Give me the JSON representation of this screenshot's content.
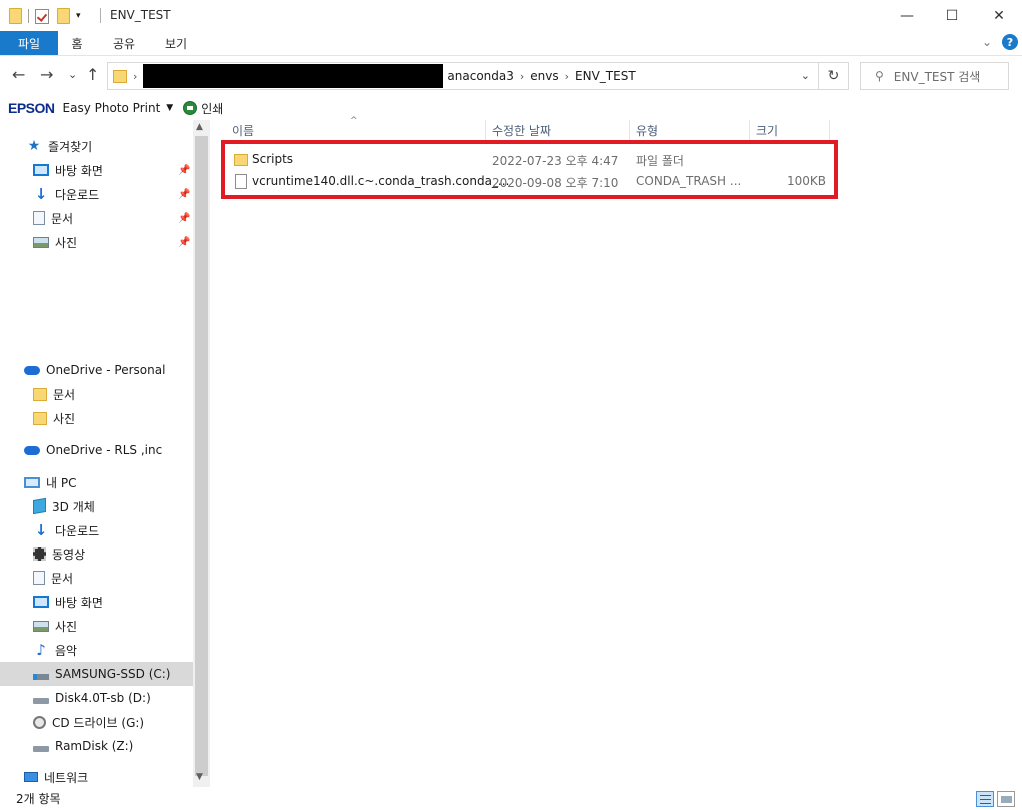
{
  "window": {
    "title": "ENV_TEST",
    "controls": {
      "minimize": "—",
      "maximize": "☐",
      "close": "✕"
    }
  },
  "ribbon": {
    "tabs": [
      "파일",
      "홈",
      "공유",
      "보기"
    ],
    "expand": "⌄",
    "help": "?"
  },
  "address": {
    "back": "←",
    "forward": "→",
    "recent": "⌄",
    "up": "↑",
    "crumbs": [
      "anaconda3",
      "envs",
      "ENV_TEST"
    ],
    "dropdown": "⌄",
    "refresh": "↻",
    "search_placeholder": "ENV_TEST 검색"
  },
  "epson": {
    "logo": "EPSON",
    "app": "Easy Photo Print",
    "print": "인쇄"
  },
  "sidebar": {
    "quick_access": {
      "label": "즐겨찾기",
      "items": [
        {
          "label": "바탕 화면",
          "icon": "desktop-icon",
          "pinned": true
        },
        {
          "label": "다운로드",
          "icon": "download-icon",
          "pinned": true
        },
        {
          "label": "문서",
          "icon": "document-icon",
          "pinned": true
        },
        {
          "label": "사진",
          "icon": "picture-icon",
          "pinned": true
        }
      ]
    },
    "onedrive_personal": {
      "label": "OneDrive - Personal",
      "items": [
        {
          "label": "문서",
          "icon": "folder-icon"
        },
        {
          "label": "사진",
          "icon": "folder-icon"
        }
      ]
    },
    "onedrive_rls": {
      "label": "OneDrive - RLS ,inc"
    },
    "this_pc": {
      "label": "내 PC",
      "items": [
        {
          "label": "3D 개체",
          "icon": "3d-objects-icon"
        },
        {
          "label": "다운로드",
          "icon": "download-icon"
        },
        {
          "label": "동영상",
          "icon": "video-icon"
        },
        {
          "label": "문서",
          "icon": "document-icon"
        },
        {
          "label": "바탕 화면",
          "icon": "desktop-icon"
        },
        {
          "label": "사진",
          "icon": "picture-icon"
        },
        {
          "label": "음악",
          "icon": "music-icon"
        },
        {
          "label": "SAMSUNG-SSD (C:)",
          "icon": "ssd-drive-icon",
          "selected": true
        },
        {
          "label": "Disk4.0T-sb (D:)",
          "icon": "drive-icon"
        },
        {
          "label": "CD 드라이브 (G:)",
          "icon": "cd-drive-icon"
        },
        {
          "label": "RamDisk (Z:)",
          "icon": "drive-icon"
        }
      ]
    },
    "network": {
      "label": "네트워크"
    }
  },
  "files": {
    "columns": [
      "이름",
      "수정한 날짜",
      "유형",
      "크기"
    ],
    "sort_indicator": "^",
    "rows": [
      {
        "name": "Scripts",
        "modified": "2022-07-23 오후 4:47",
        "type": "파일 폴더",
        "size": "",
        "icon": "folder-icon"
      },
      {
        "name": "vcruntime140.dll.c~.conda_trash.conda_...",
        "modified": "2020-09-08 오후 7:10",
        "type": "CONDA_TRASH ...",
        "size": "100KB",
        "icon": "file-icon"
      }
    ]
  },
  "status": {
    "item_count": "2개 항목"
  },
  "colors": {
    "accent": "#1979ca",
    "highlight_border": "#e01b24",
    "selected_bg": "#d9d9d9"
  }
}
